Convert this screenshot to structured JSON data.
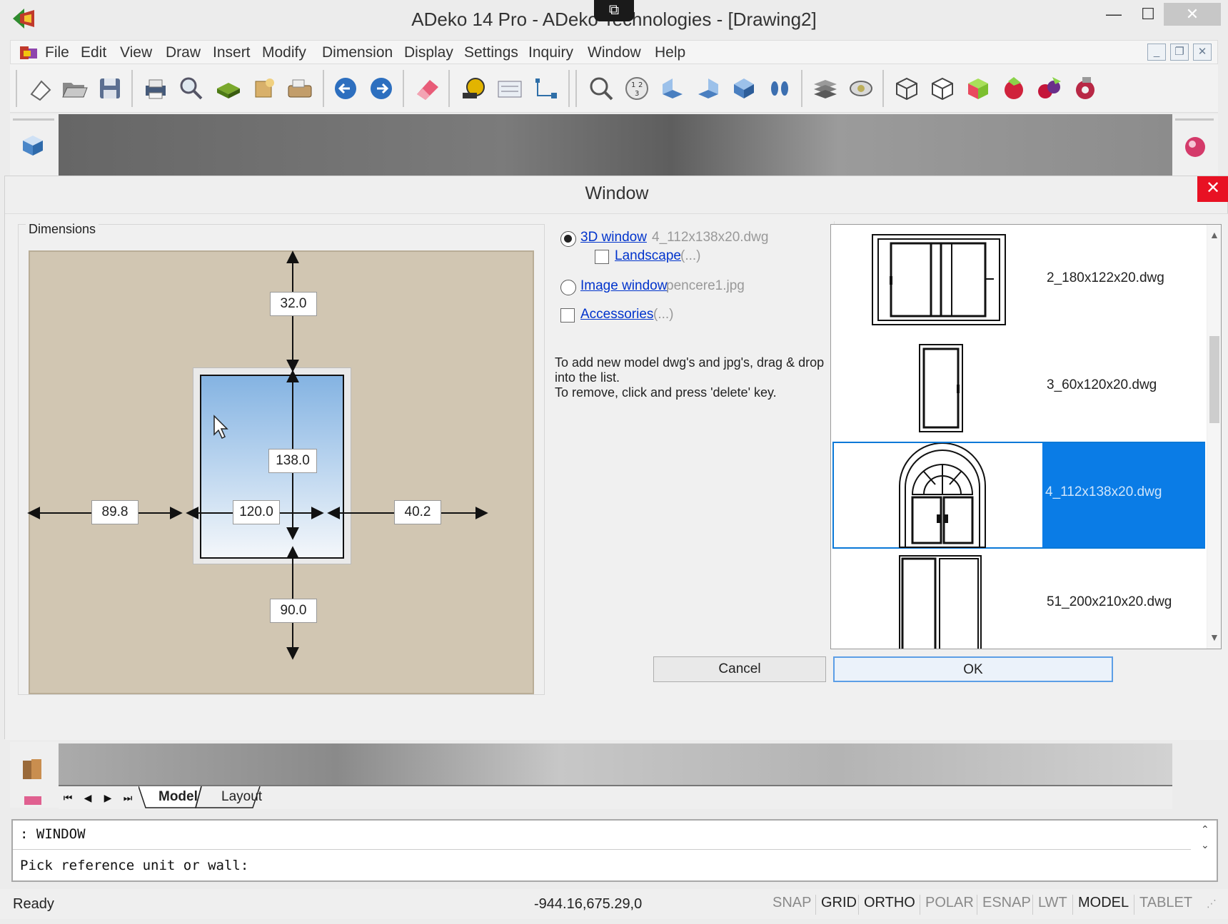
{
  "app": {
    "title": "ADeko 14 Pro  - ADeko Technologies - [Drawing2]",
    "min_glyph": "—",
    "max_glyph": "☐",
    "close_glyph": "✕",
    "share_glyph": "⧉"
  },
  "menu": {
    "items": [
      "File",
      "Edit",
      "View",
      "Draw",
      "Insert",
      "Modify",
      "Dimension",
      "Display",
      "Settings",
      "Inquiry",
      "Window",
      "Help"
    ],
    "mdi_min": "_",
    "mdi_restore": "❐",
    "mdi_close": "✕"
  },
  "toolbar": {
    "icons": [
      "new-file-icon",
      "open-folder-icon",
      "save-icon",
      "print-icon",
      "print-preview-icon",
      "block-icon",
      "render-icon",
      "scanner-icon",
      "undo-icon",
      "redo-icon",
      "erase-icon",
      "measure-icon",
      "list-icon",
      "tree-icon",
      "zoom-icon",
      "zoom-number-icon",
      "view-front-icon",
      "view-side-icon",
      "view-3d-icon",
      "footprints-icon",
      "layers-icon",
      "visibility-icon",
      "wireframe-cube-icon",
      "hidden-cube-icon",
      "shaded-cube-icon",
      "red-sphere-icon",
      "material-icon",
      "settings-sphere-icon"
    ]
  },
  "dialog": {
    "title": "Window",
    "close_glyph": "✕",
    "dimensions_label": "Dimensions",
    "dims": {
      "top": "32.0",
      "height": "138.0",
      "left": "89.8",
      "width": "120.0",
      "right": "40.2",
      "bottom": "90.0"
    },
    "options": {
      "window3d_label": "3D window",
      "window3d_file": "4_112x138x20.dwg",
      "window3d_checked": true,
      "landscape_label": "Landscape",
      "landscape_extra": "(...)",
      "image_window_label": "Image window",
      "image_window_file": "pencere1.jpg",
      "accessories_label": "Accessories",
      "accessories_extra": "(...)"
    },
    "help_text": "To add new model dwg's and jpg's, drag & drop into the list.\nTo remove, click and press 'delete' key.",
    "models": [
      {
        "name": "2_180x122x20.dwg",
        "selected": false
      },
      {
        "name": "3_60x120x20.dwg",
        "selected": false
      },
      {
        "name": "4_112x138x20.dwg",
        "selected": true
      },
      {
        "name": "51_200x210x20.dwg",
        "selected": false
      }
    ],
    "cancel_label": "Cancel",
    "ok_label": "OK"
  },
  "tabs": {
    "model": "Model",
    "layout": "Layout"
  },
  "command": {
    "line1": ": WINDOW",
    "line2": "Pick reference unit or wall:"
  },
  "status": {
    "ready": "Ready",
    "coords": "-944.16,675.29,0",
    "toggles": [
      {
        "label": "SNAP",
        "on": false
      },
      {
        "label": "GRID",
        "on": true
      },
      {
        "label": "ORTHO",
        "on": true
      },
      {
        "label": "POLAR",
        "on": false
      },
      {
        "label": "ESNAP",
        "on": false
      },
      {
        "label": "LWT",
        "on": false
      },
      {
        "label": "MODEL",
        "on": true
      },
      {
        "label": "TABLET",
        "on": false
      }
    ]
  },
  "colors": {
    "selection": "#0a7ce6",
    "close_red": "#e81123",
    "link_blue": "#0033cc",
    "wall": "#d1c6b2"
  }
}
